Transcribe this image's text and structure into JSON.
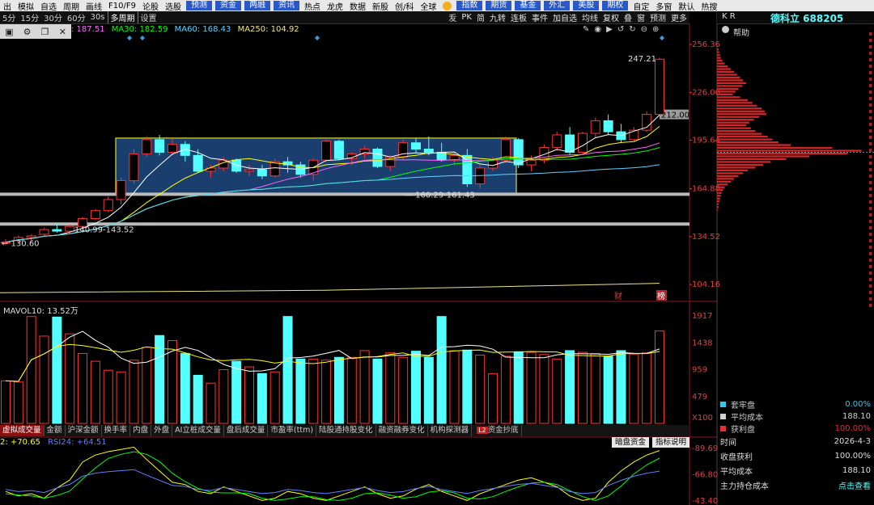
{
  "menubar": {
    "items": [
      "出",
      "模拟",
      "自选",
      "周期",
      "画线",
      "F10/F9",
      "论股",
      "选股"
    ],
    "blue_items": [
      "预测",
      "资金",
      "两融",
      "资讯"
    ],
    "items2": [
      "热点",
      "龙虎",
      "数据",
      "新股",
      "创/科",
      "全球"
    ],
    "blue_items2": [
      "指数",
      "期货",
      "基金",
      "外汇",
      "美股",
      "期权"
    ],
    "items3": [
      "自定",
      "多窗",
      "默认",
      "热搜"
    ]
  },
  "toolbar": {
    "periods": [
      "5分",
      "15分",
      "30分",
      "60分",
      "30s"
    ],
    "selected_period": "多周期",
    "settings": "设置",
    "right_items": [
      "叐",
      "PK",
      "简",
      "九转",
      "连板",
      "事件",
      "加自选",
      "均线",
      "复权",
      "叠",
      "窗",
      "预测",
      "更多"
    ]
  },
  "ma_legend": {
    "ma5": ": 187.51",
    "ma30": "MA30: 182.59",
    "ma60": "MA60: 168.43",
    "ma250": "MA250: 104.92"
  },
  "colors": {
    "up": "#ff3232",
    "down": "#54ffff",
    "ma5": "#ffffff",
    "ma10": "#ffff00",
    "ma20": "#ff66ff",
    "ma30": "#00ff00",
    "ma60": "#5fd3ff",
    "ma250": "#f0e68c",
    "box": "#1e4a82",
    "box_border": "#ffff40",
    "brand": "#54ffff"
  },
  "right_panel": {
    "kr": "K R",
    "stock_name": "德科立 688205",
    "help": "帮助",
    "legend": [
      {
        "label": "套牢盘",
        "value": "0.00%",
        "color": "#3cc3e8"
      },
      {
        "label": "平均成本",
        "value": "188.10",
        "color": "#d0d0d0"
      },
      {
        "label": "获利盘",
        "value": "100.00%",
        "color": "#e03030"
      }
    ],
    "info": [
      {
        "label": "时间",
        "value": "2026-4-3"
      },
      {
        "label": "收盘获利",
        "value": "100.00%"
      },
      {
        "label": "平均成本",
        "value": "188.10"
      },
      {
        "label": "主力持仓成本",
        "value": "点击查看"
      }
    ]
  },
  "price_axis": [
    "256.36",
    "226.00",
    "195.64",
    "164.88",
    "134.52",
    "104.16"
  ],
  "annotations": {
    "high": "247.21",
    "last": "212.00",
    "box_low": "160.29-161.43",
    "support": "140.99-143.52",
    "low": "130.60",
    "cai": "财",
    "bang": "榜"
  },
  "volume": {
    "legend": "MAVOL10: 13.52万",
    "axis": [
      "1917",
      "1438",
      "959",
      "479",
      "X100"
    ]
  },
  "tabs": {
    "items": [
      "虚拟成交量",
      "金额",
      "沪深金额",
      "换手率",
      "内盘",
      "外盘",
      "AI立桩成交量",
      "盘后成交量",
      "市盈率(ttm)",
      "陆股通持股变化",
      "融资融券变化",
      "机构探测器",
      "资金抄底"
    ],
    "l2": "L2"
  },
  "rsi": {
    "legend_a": "2: +70.65",
    "legend_b": "RSI24: +64.51",
    "buttons": [
      "暗盘资金",
      "指标说明"
    ],
    "axis": [
      "89.69",
      "66.80",
      "43.40"
    ]
  },
  "chart_data": {
    "type": "candlestick",
    "ohlc": [
      [
        131,
        133,
        129,
        131
      ],
      [
        132,
        135,
        130,
        134
      ],
      [
        134,
        136,
        131,
        135
      ],
      [
        136,
        140,
        135,
        139
      ],
      [
        139,
        143,
        137,
        138
      ],
      [
        138,
        142,
        136,
        141
      ],
      [
        141,
        147,
        140,
        146
      ],
      [
        146,
        152,
        145,
        151
      ],
      [
        151,
        160,
        150,
        158
      ],
      [
        158,
        172,
        155,
        170
      ],
      [
        170,
        190,
        168,
        187
      ],
      [
        187,
        198,
        185,
        196
      ],
      [
        196,
        199,
        186,
        188
      ],
      [
        188,
        197,
        186,
        193
      ],
      [
        193,
        195,
        182,
        186
      ],
      [
        186,
        190,
        175,
        176
      ],
      [
        176,
        180,
        172,
        178
      ],
      [
        178,
        185,
        176,
        183
      ],
      [
        183,
        184,
        175,
        176
      ],
      [
        176,
        180,
        173,
        177
      ],
      [
        177,
        180,
        171,
        173
      ],
      [
        173,
        184,
        172,
        182
      ],
      [
        182,
        185,
        175,
        180
      ],
      [
        180,
        182,
        172,
        174
      ],
      [
        174,
        184,
        170,
        183
      ],
      [
        183,
        196,
        182,
        195
      ],
      [
        195,
        196,
        183,
        184
      ],
      [
        184,
        188,
        180,
        187
      ],
      [
        187,
        192,
        184,
        190
      ],
      [
        190,
        191,
        178,
        179
      ],
      [
        179,
        186,
        176,
        185
      ],
      [
        185,
        196,
        183,
        194
      ],
      [
        194,
        197,
        188,
        190
      ],
      [
        190,
        198,
        186,
        188
      ],
      [
        188,
        194,
        182,
        183
      ],
      [
        183,
        188,
        180,
        186
      ],
      [
        186,
        190,
        166,
        168
      ],
      [
        168,
        180,
        165,
        178
      ],
      [
        178,
        185,
        176,
        183
      ],
      [
        183,
        198,
        181,
        196
      ],
      [
        196,
        197,
        178,
        180
      ],
      [
        180,
        186,
        176,
        183
      ],
      [
        183,
        193,
        181,
        191
      ],
      [
        191,
        201,
        189,
        199
      ],
      [
        199,
        204,
        186,
        188
      ],
      [
        188,
        201,
        187,
        200
      ],
      [
        200,
        210,
        197,
        208
      ],
      [
        208,
        212,
        199,
        201
      ],
      [
        201,
        206,
        194,
        196
      ],
      [
        196,
        204,
        195,
        202
      ],
      [
        202,
        214,
        201,
        212
      ],
      [
        212,
        248,
        211,
        247
      ]
    ],
    "volume_axis_max": 1917,
    "price_range": [
      104.16,
      256.36
    ]
  }
}
